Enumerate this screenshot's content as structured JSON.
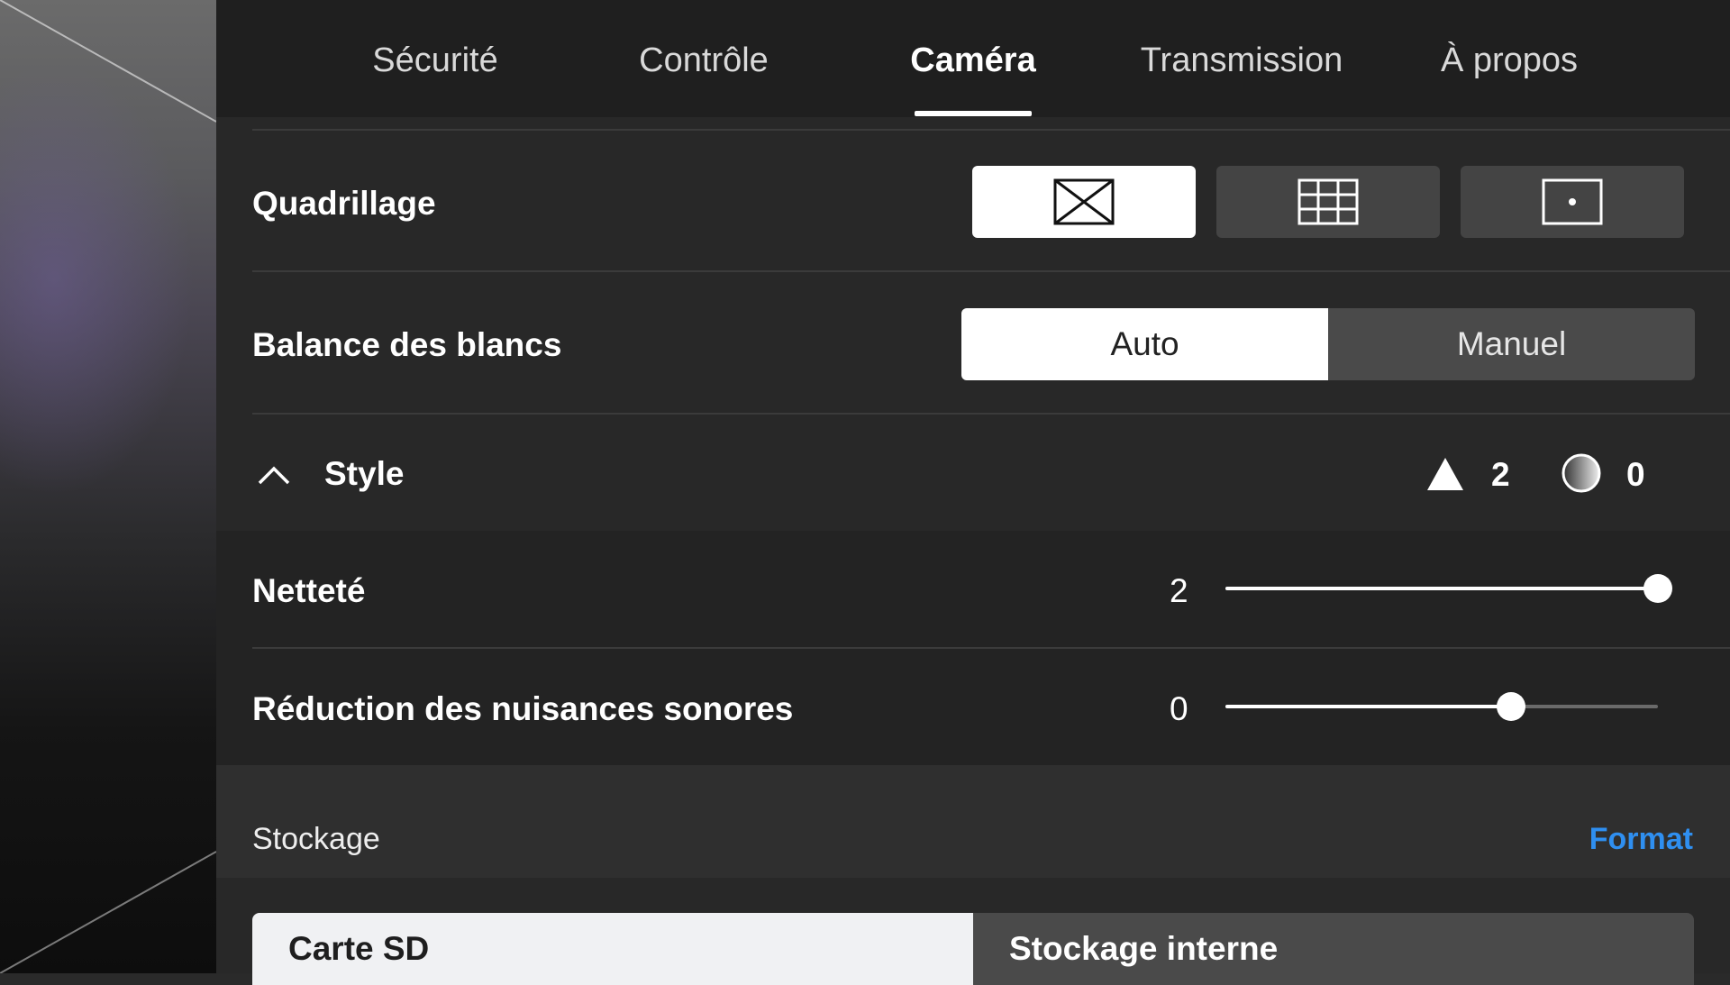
{
  "tabs": [
    {
      "label": "Sécurité",
      "active": false
    },
    {
      "label": "Contrôle",
      "active": false
    },
    {
      "label": "Caméra",
      "active": true
    },
    {
      "label": "Transmission",
      "active": false
    },
    {
      "label": "À propos",
      "active": false
    }
  ],
  "grid": {
    "label": "Quadrillage",
    "options": [
      {
        "icon": "diagonal-grid-icon",
        "selected": true
      },
      {
        "icon": "grid-3x3-icon",
        "selected": false
      },
      {
        "icon": "center-point-icon",
        "selected": false
      }
    ]
  },
  "white_balance": {
    "label": "Balance des blancs",
    "options": [
      "Auto",
      "Manuel"
    ],
    "selected": "Auto"
  },
  "style": {
    "label": "Style",
    "expanded": true,
    "summary": [
      {
        "icon": "sharpness-triangle-icon",
        "value": "2"
      },
      {
        "icon": "noise-gradient-circle-icon",
        "value": "0"
      }
    ],
    "sliders": [
      {
        "label": "Netteté",
        "value": "2",
        "fraction": 1.0
      },
      {
        "label": "Réduction des nuisances sonores",
        "value": "0",
        "fraction": 0.66
      }
    ]
  },
  "storage": {
    "title": "Stockage",
    "format_label": "Format",
    "options": [
      "Carte SD",
      "Stockage interne"
    ],
    "selected": "Carte SD"
  },
  "colors": {
    "accent": "#2f8ff0",
    "panel": "#282828",
    "tab_bar": "#1f1f1f"
  }
}
